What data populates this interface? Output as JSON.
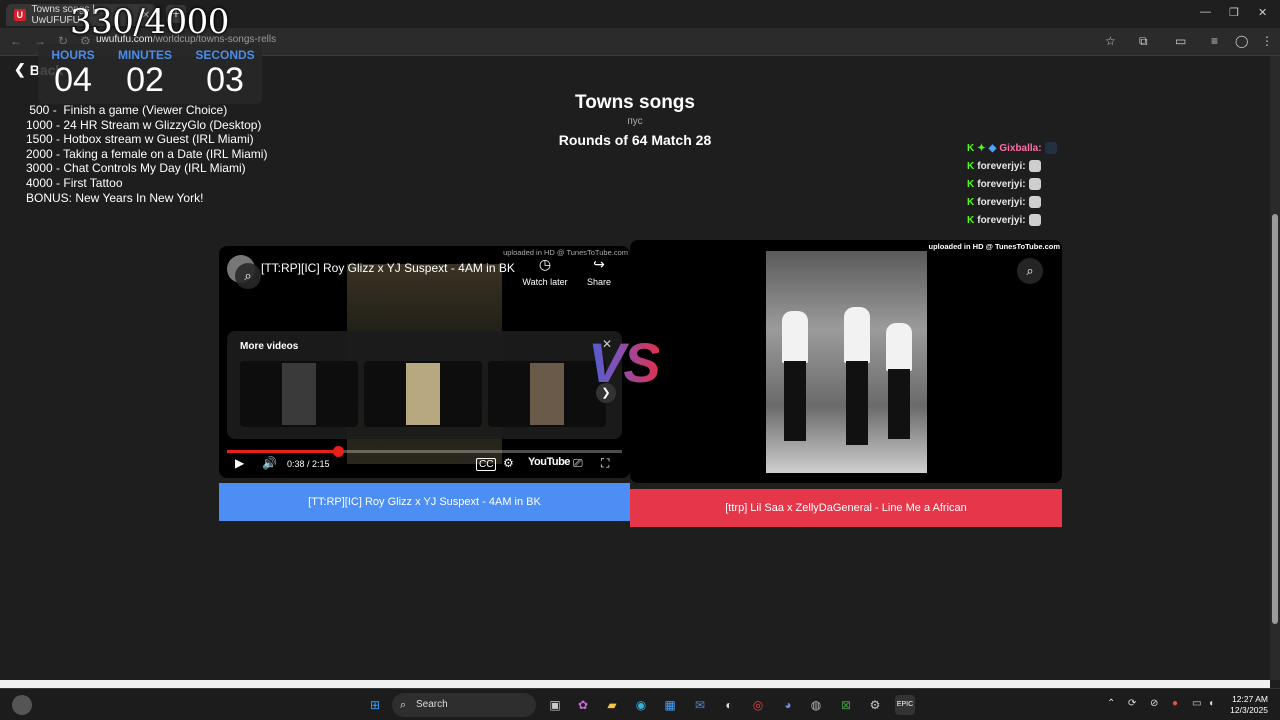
{
  "browser": {
    "tab_title": "Towns songs | UwUFUFU",
    "favicon_letter": "U",
    "new_tab": "+",
    "url_host": "uwufufu.com",
    "url_path": "/worldcup/towns-songs-rells"
  },
  "overlay": {
    "goal_count": "330/4000",
    "timer": {
      "hours_label": "HOURS",
      "hours": "04",
      "minutes_label": "MINUTES",
      "minutes": "02",
      "seconds_label": "SECONDS",
      "seconds": "03"
    },
    "goals": [
      " 500 -  Finish a game (Viewer Choice)",
      "1000 - 24 HR Stream w GlizzyGlo (Desktop)",
      "1500 - Hotbox stream w Guest (IRL Miami)",
      "2000 - Taking a female on a Date (IRL Miami)",
      "3000 - Chat Controls My Day (IRL Miami)",
      "4000 - First Tattoo",
      "BONUS: New Years In New York!"
    ]
  },
  "page": {
    "back_label": "Back",
    "title": "Towns songs",
    "subtitle": "пус",
    "round": "Rounds of 64 Match 28"
  },
  "chat": [
    {
      "badge": "K",
      "name": "Gixballa:",
      "style": "pink"
    },
    {
      "badge": "K",
      "name": "foreverjyi:",
      "style": "white"
    },
    {
      "badge": "K",
      "name": "foreverjyi:",
      "style": "white"
    },
    {
      "badge": "K",
      "name": "foreverjyi:",
      "style": "white"
    },
    {
      "badge": "K",
      "name": "foreverjyi:",
      "style": "white"
    }
  ],
  "left_card": {
    "watermark": "uploaded in HD @ TunesToTube.com",
    "video_title": "[TT:RP][IC] Roy Glizz x YJ Suspext - 4AM in BK",
    "watch_later": "Watch later",
    "share": "Share",
    "more_videos": "More videos",
    "time": "0:38 / 2:15",
    "progress_fraction": 0.281,
    "brand": "YouTube",
    "choice_label": "[TT:RP][IC] Roy Glizz x YJ Suspext - 4AM in BK"
  },
  "right_card": {
    "watermark": "uploaded in HD @ TunesToTube.com",
    "choice_label": "[ttrp] Lil Saa x ZellyDaGeneral - Line Me a African"
  },
  "vs_label": "VS",
  "taskbar": {
    "search_label": "Search",
    "time": "12:27 AM",
    "date": "12/3/2025"
  },
  "colors": {
    "left_choice": "#4d8ef5",
    "right_choice": "#e5364a",
    "timer_label": "#4d8ce8",
    "progress": "#e62117"
  }
}
